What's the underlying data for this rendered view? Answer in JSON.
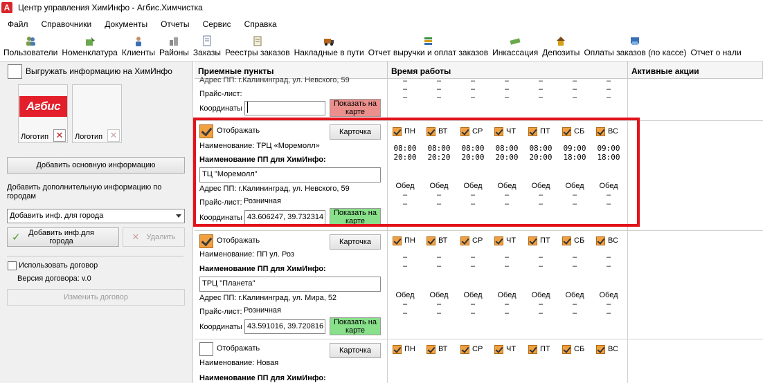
{
  "window": {
    "title": "Центр управления ХимИнфо - Агбис.Химчистка",
    "icon_letter": "A"
  },
  "menu": [
    "Файл",
    "Справочники",
    "Документы",
    "Отчеты",
    "Сервис",
    "Справка"
  ],
  "toolbar": [
    {
      "label": "Пользователи",
      "icon": "users-icon"
    },
    {
      "label": "Номенклатура",
      "icon": "nomenclature-icon"
    },
    {
      "label": "Клиенты",
      "icon": "clients-icon"
    },
    {
      "label": "Районы",
      "icon": "districts-icon"
    },
    {
      "label": "Заказы",
      "icon": "orders-icon"
    },
    {
      "label": "Реестры заказов",
      "icon": "registry-icon"
    },
    {
      "label": "Накладные в пути",
      "icon": "invoices-icon"
    },
    {
      "label": "Отчет выручки и оплат заказов",
      "icon": "report-icon"
    },
    {
      "label": "Инкассация",
      "icon": "cash-icon"
    },
    {
      "label": "Депозиты",
      "icon": "deposit-icon"
    },
    {
      "label": "Оплаты заказов (по кассе)",
      "icon": "payments-icon"
    },
    {
      "label": "Отчет о нали",
      "icon": "report2-icon"
    }
  ],
  "left": {
    "export_label": "Выгружать информацию на ХимИнфо",
    "logo_text": "Агбис",
    "logo1_label": "Логотип",
    "logo2_label": "Логотип",
    "add_main_info": "Добавить основную информацию",
    "add_extra_title": "Добавить дополнительную информацию по городам",
    "city_combo": "Добавить инф. для города",
    "add_city_btn": "Добавить инф.для города",
    "delete_btn": "Удалить",
    "use_contract": "Использовать договор",
    "contract_version": "Версия договора: v.0",
    "change_contract": "Изменить договор"
  },
  "grid": {
    "headers": [
      "Приемные пункты",
      "Время работы",
      "Активные акции"
    ],
    "labels": {
      "display": "Отображать",
      "card": "Карточка",
      "name_prefix": "Наименование: ",
      "pp_name": "Наименование ПП для ХимИнфо:",
      "address_prefix": "Адрес ПП: ",
      "pricelist": "Прайс-лист:",
      "coords": "Координаты",
      "show_map": "Показать на карте",
      "lunch": "Обед"
    },
    "days": [
      "ПН",
      "ВТ",
      "СР",
      "ЧТ",
      "ПТ",
      "СБ",
      "ВС"
    ],
    "row0": {
      "address_partial": "Адрес ПП: г.Калининград, ул. Невского, 59",
      "coords": ""
    },
    "row1": {
      "display": true,
      "name": "ТРЦ «Моремолл»",
      "pp_name": "ТЦ \"Моремолл\"",
      "address": "г.Калининград, ул. Невского, 59",
      "pricelist": "Розничная",
      "coords": "43.606247, 39.732314",
      "open": [
        "08:00",
        "08:00",
        "08:00",
        "08:00",
        "08:00",
        "09:00",
        "09:00"
      ],
      "close": [
        "20:00",
        "20:20",
        "20:00",
        "20:00",
        "20:00",
        "18:00",
        "18:00"
      ]
    },
    "row2": {
      "display": true,
      "name": "ПП ул. Роз",
      "pp_name": "ТРЦ \"Планета\"",
      "address": "г.Калининград, ул. Мира, 52",
      "pricelist": "Розничная",
      "coords": "43.591016, 39.720816"
    },
    "row3": {
      "display": false,
      "name": "Новая"
    },
    "dash": "–"
  }
}
